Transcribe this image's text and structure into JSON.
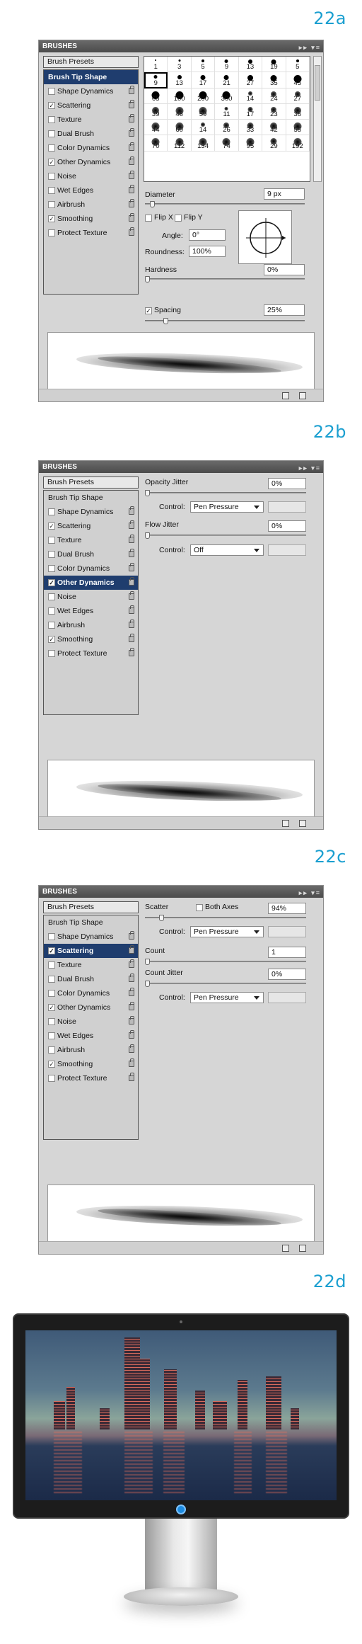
{
  "figures": {
    "a": {
      "label": "22a"
    },
    "b": {
      "label": "22b"
    },
    "c": {
      "label": "22c"
    },
    "d": {
      "label": "22d"
    }
  },
  "panel_title": "BRUSHES",
  "presets_label": "Brush Presets",
  "header_item": "Brush Tip Shape",
  "items": [
    {
      "label": "Shape Dynamics"
    },
    {
      "label": "Scattering"
    },
    {
      "label": "Texture"
    },
    {
      "label": "Dual Brush"
    },
    {
      "label": "Color Dynamics"
    },
    {
      "label": "Other Dynamics"
    },
    {
      "label": "Noise"
    },
    {
      "label": "Wet Edges"
    },
    {
      "label": "Airbrush"
    },
    {
      "label": "Smoothing"
    },
    {
      "label": "Protect Texture"
    }
  ],
  "checked_a": [
    false,
    true,
    false,
    false,
    false,
    true,
    false,
    false,
    false,
    true,
    false
  ],
  "tip_sizes": [
    "1",
    "3",
    "5",
    "9",
    "13",
    "19",
    "5",
    "9",
    "13",
    "17",
    "21",
    "27",
    "35",
    "45",
    "65",
    "100",
    "200",
    "300",
    "14",
    "24",
    "27",
    "39",
    "46",
    "59",
    "11",
    "17",
    "23",
    "36",
    "44",
    "60",
    "14",
    "26",
    "33",
    "42",
    "55",
    "70",
    "112",
    "134",
    "74",
    "95",
    "29",
    "192"
  ],
  "panel_a": {
    "diameter_label": "Diameter",
    "diameter_value": "9 px",
    "diameter_level_fraction": 0.03,
    "flipx_label": "Flip X",
    "flipy_label": "Flip Y",
    "angle_label": "Angle:",
    "angle_value": "0°",
    "roundness_label": "Roundness:",
    "roundness_value": "100%",
    "hardness_label": "Hardness",
    "hardness_value": "0%",
    "hardness_level_fraction": 0.0,
    "spacing_label": "Spacing",
    "spacing_value": "25%",
    "spacing_level_fraction": 0.12
  },
  "panel_b": {
    "opacity_label": "Opacity Jitter",
    "opacity_value": "0%",
    "control_label": "Control:",
    "control_value_1": "Pen Pressure",
    "flow_label": "Flow Jitter",
    "flow_value": "0%",
    "control_value_2": "Off"
  },
  "panel_c": {
    "scatter_label": "Scatter",
    "both_axes_label": "Both Axes",
    "scatter_value": "94%",
    "scatter_level_fraction": 0.09,
    "control_label": "Control:",
    "control_value_1": "Pen Pressure",
    "count_label": "Count",
    "count_value": "1",
    "count_jitter_label": "Count Jitter",
    "count_jitter_value": "0%",
    "control_value_2": "Pen Pressure"
  }
}
